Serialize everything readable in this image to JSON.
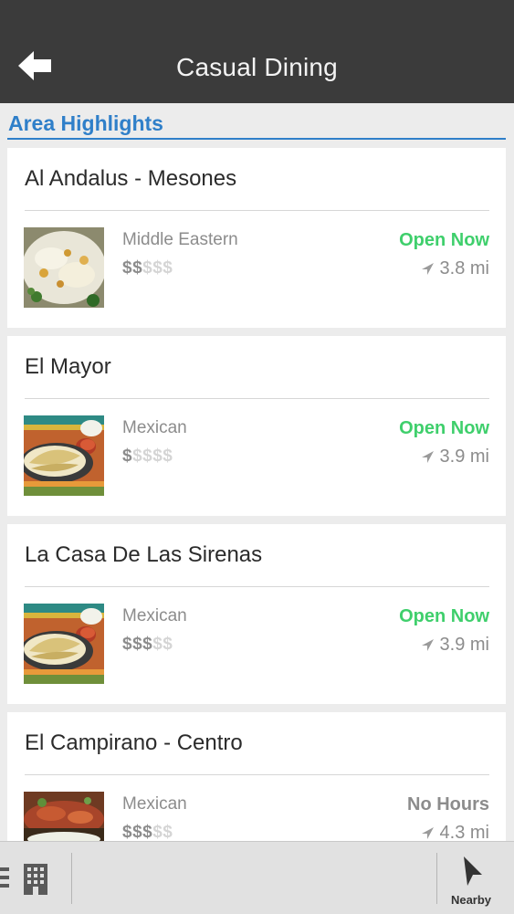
{
  "header": {
    "title": "Casual Dining"
  },
  "section": {
    "title": "Area Highlights"
  },
  "colors": {
    "open": "#3fcf6c",
    "no_hours": "#8c8c8c",
    "accent": "#2f7fc9"
  },
  "restaurants": [
    {
      "name": "Al Andalus - Mesones",
      "cuisine": "Middle Eastern",
      "price_on": "$$",
      "price_off": "$$$",
      "status": "Open Now",
      "status_type": "open",
      "distance": "3.8 mi",
      "image": "mediterranean-dish"
    },
    {
      "name": "El Mayor",
      "cuisine": "Mexican",
      "price_on": "$",
      "price_off": "$$$$",
      "status": "Open Now",
      "status_type": "open",
      "distance": "3.9 mi",
      "image": "mexican-dish"
    },
    {
      "name": "La Casa De Las Sirenas",
      "cuisine": "Mexican",
      "price_on": "$$$",
      "price_off": "$$",
      "status": "Open Now",
      "status_type": "open",
      "distance": "3.9 mi",
      "image": "mexican-dish"
    },
    {
      "name": "El Campirano - Centro",
      "cuisine": "Mexican",
      "price_on": "$$$",
      "price_off": "$$",
      "status": "No Hours",
      "status_type": "none",
      "distance": "4.3 mi",
      "image": "enchiladas-dish"
    }
  ],
  "bottom_bar": {
    "nearby_label": "Nearby",
    "icons": [
      "list-icon",
      "building-icon",
      "location-arrow-icon"
    ]
  }
}
